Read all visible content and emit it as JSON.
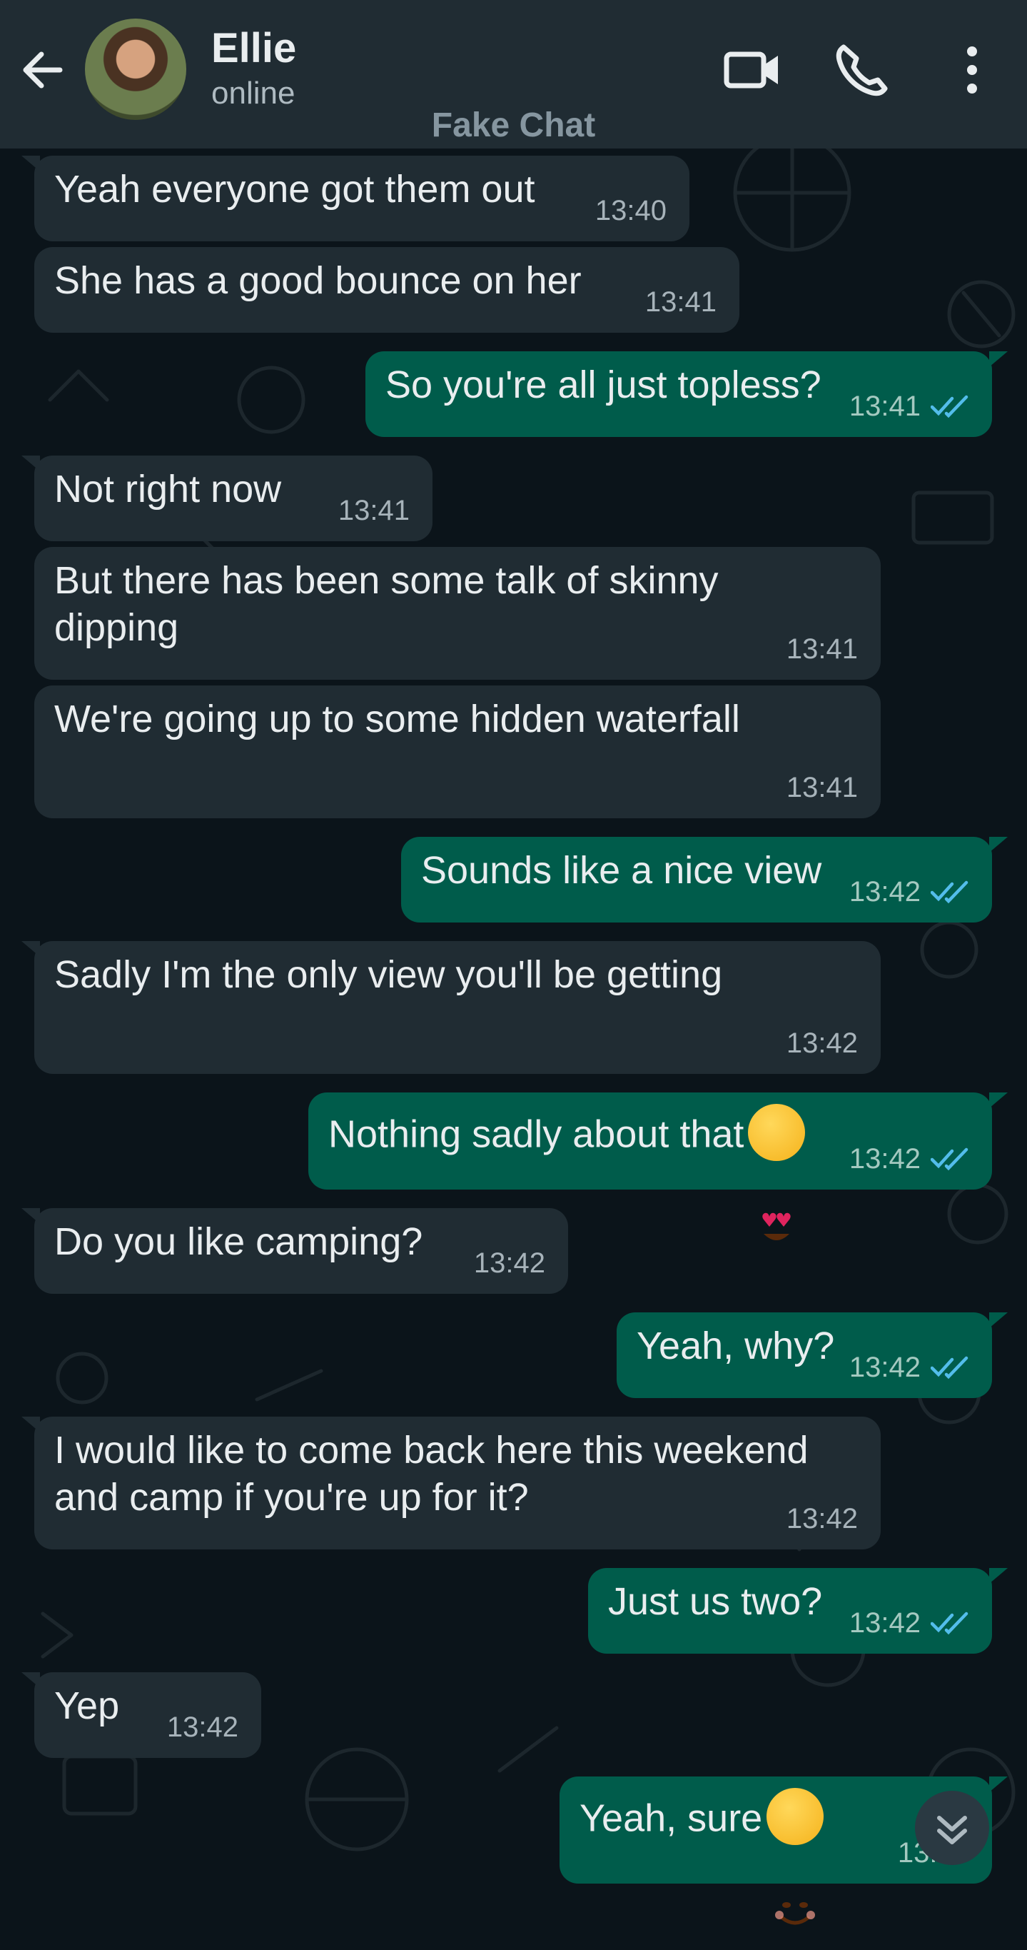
{
  "header": {
    "contact_name": "Ellie",
    "status": "online",
    "watermark": "Fake Chat",
    "icons": [
      "back-arrow-icon",
      "video-call-icon",
      "voice-call-icon",
      "more-options-icon"
    ]
  },
  "colors": {
    "header_bg": "#202c33",
    "chat_bg": "#0b141a",
    "incoming_bubble": "#202c33",
    "outgoing_bubble": "#005c4b",
    "read_ticks": "#53bdeb"
  },
  "messages": [
    {
      "dir": "in",
      "text": "Yeah everyone got them out",
      "time": "13:40"
    },
    {
      "dir": "in",
      "text": "She has a good bounce on her",
      "time": "13:41"
    },
    {
      "dir": "out",
      "text": "So you're all just topless?",
      "time": "13:41",
      "status": "read"
    },
    {
      "dir": "in",
      "text": "Not right now",
      "time": "13:41"
    },
    {
      "dir": "in",
      "text": "But there has been some talk of skinny\ndipping",
      "time": "13:41"
    },
    {
      "dir": "in",
      "text": "We're going up to some hidden waterfall",
      "time": "13:41"
    },
    {
      "dir": "out",
      "text": "Sounds like a nice view",
      "time": "13:42",
      "status": "read"
    },
    {
      "dir": "in",
      "text": "Sadly I'm the only view you'll be getting",
      "time": "13:42"
    },
    {
      "dir": "out",
      "text": "Nothing sadly about that",
      "emoji": "heart-eyes-emoji",
      "time": "13:42",
      "status": "read"
    },
    {
      "dir": "in",
      "text": "Do you like camping?",
      "time": "13:42"
    },
    {
      "dir": "out",
      "text": "Yeah, why?",
      "time": "13:42",
      "status": "read"
    },
    {
      "dir": "in",
      "text": "I would like to come back here this weekend\nand camp if you're up for it?",
      "time": "13:42"
    },
    {
      "dir": "out",
      "text": "Just us two?",
      "time": "13:42",
      "status": "read"
    },
    {
      "dir": "in",
      "text": "Yep",
      "time": "13:42"
    },
    {
      "dir": "out",
      "text": "Yeah, sure",
      "emoji": "smiling-emoji",
      "time": "13:43",
      "status": "read"
    }
  ],
  "scroll_button": {
    "icon": "chevron-double-down-icon"
  }
}
